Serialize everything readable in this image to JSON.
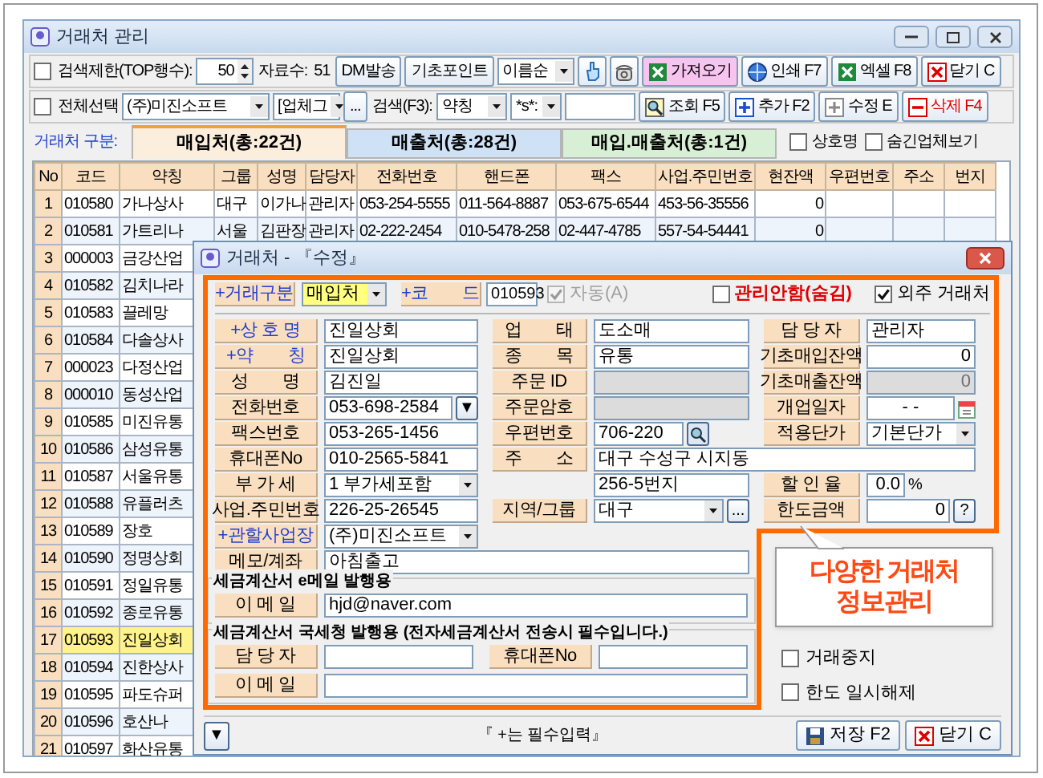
{
  "window": {
    "title": "거래처 관리"
  },
  "toolbar_1": [
    {
      "kind": "checkbox",
      "label": "검색제한(TOP행수):",
      "checked": false
    },
    {
      "kind": "spin",
      "value": "50"
    },
    {
      "kind": "label",
      "text": "자료수:"
    },
    {
      "kind": "label",
      "text": "51"
    },
    {
      "kind": "button",
      "label": "DM발송"
    },
    {
      "kind": "button",
      "label": "기초포인트"
    },
    {
      "kind": "select",
      "value": "이름순"
    },
    {
      "kind": "icon_button"
    },
    {
      "kind": "icon_button"
    },
    {
      "kind": "accent_button",
      "label": "가져오기"
    },
    {
      "kind": "button",
      "label": "인쇄 F7"
    },
    {
      "kind": "button",
      "label": "엑셀 F8"
    },
    {
      "kind": "button",
      "label": "닫기 C"
    }
  ],
  "toolbar_2": [
    {
      "kind": "checkbox",
      "label": "전체선택",
      "checked": false
    },
    {
      "kind": "select",
      "value": "(주)미진소프트"
    },
    {
      "kind": "select",
      "value": "[업체그"
    },
    {
      "kind": "button",
      "label": "..."
    },
    {
      "kind": "label",
      "text": "검색(F3):"
    },
    {
      "kind": "select",
      "value": "약칭"
    },
    {
      "kind": "select",
      "value": "*s*:"
    },
    {
      "kind": "input"
    },
    {
      "kind": "button",
      "label": "조회 F5"
    },
    {
      "kind": "button",
      "label": "추가 F2"
    },
    {
      "kind": "button",
      "label": "수정 E"
    },
    {
      "kind": "danger_button",
      "label": "삭제 F4"
    }
  ],
  "category_label": "거래처 구분:",
  "tabs": [
    {
      "label": "매입처(총:22건)",
      "selected": true,
      "color": "#fbeedd"
    },
    {
      "label": "매출처(총:28건)",
      "selected": false,
      "color": "#cfe2f5"
    },
    {
      "label": "매입.매출처(총:1건)",
      "selected": false,
      "color": "#d7efd4"
    }
  ],
  "filters": [
    {
      "label": "상호명",
      "checked": false
    },
    {
      "label": "숨긴업체보기",
      "checked": false
    }
  ],
  "table": {
    "columns": [
      "No",
      "코드",
      "약칭",
      "그룹",
      "성명",
      "담당자",
      "전화번호",
      "핸드폰",
      "팩스",
      "사업.주민번호",
      "현잔액",
      "우편번호",
      "주소",
      "번지"
    ],
    "rows": [
      {
        "selected": false,
        "cells": [
          "1",
          "010580",
          "가나상사",
          "대구",
          "이가나",
          "관리자",
          "053-254-5555",
          "011-564-8887",
          "053-675-6544",
          "453-56-35556",
          "0"
        ]
      },
      {
        "selected": false,
        "cells": [
          "2",
          "010581",
          "가트리나",
          "서울",
          "김판장",
          "관리자",
          "02-222-2454",
          "010-5478-258",
          "02-447-4785",
          "557-54-54441",
          "0"
        ]
      },
      {
        "selected": false,
        "cells": [
          "3",
          "000003",
          "금강산업"
        ]
      },
      {
        "selected": false,
        "cells": [
          "4",
          "010582",
          "김치나라"
        ]
      },
      {
        "selected": false,
        "cells": [
          "5",
          "010583",
          "끌레망"
        ]
      },
      {
        "selected": false,
        "cells": [
          "6",
          "010584",
          "다솔상사"
        ]
      },
      {
        "selected": false,
        "cells": [
          "7",
          "000023",
          "다정산업"
        ]
      },
      {
        "selected": false,
        "cells": [
          "8",
          "000010",
          "동성산업"
        ]
      },
      {
        "selected": false,
        "cells": [
          "9",
          "010585",
          "미진유통"
        ]
      },
      {
        "selected": false,
        "cells": [
          "10",
          "010586",
          "삼성유통"
        ]
      },
      {
        "selected": false,
        "cells": [
          "11",
          "010587",
          "서울유통"
        ]
      },
      {
        "selected": false,
        "cells": [
          "12",
          "010588",
          "유플러츠"
        ]
      },
      {
        "selected": false,
        "cells": [
          "13",
          "010589",
          "장호"
        ]
      },
      {
        "selected": false,
        "cells": [
          "14",
          "010590",
          "정명상회"
        ]
      },
      {
        "selected": false,
        "cells": [
          "15",
          "010591",
          "정일유통"
        ]
      },
      {
        "selected": false,
        "cells": [
          "16",
          "010592",
          "종로유통"
        ]
      },
      {
        "selected": true,
        "cells": [
          "17",
          "010593",
          "진일상회"
        ]
      },
      {
        "selected": false,
        "cells": [
          "18",
          "010594",
          "진한상사"
        ]
      },
      {
        "selected": false,
        "cells": [
          "19",
          "010595",
          "파도슈퍼"
        ]
      },
      {
        "selected": false,
        "cells": [
          "20",
          "010596",
          "호산나"
        ]
      },
      {
        "selected": false,
        "cells": [
          "21",
          "010597",
          "화산유통"
        ]
      }
    ]
  },
  "dialog": {
    "title": "거래처 - 『수정』",
    "type_field": {
      "label": "+거래구분",
      "value": "매입처"
    },
    "code_field": {
      "label": "+코　　드",
      "value": "010593"
    },
    "checks": [
      {
        "label": "자동(A)",
        "checked": true,
        "disabled": true
      },
      {
        "label": "관리안함(숨김)",
        "checked": false,
        "disabled": false
      },
      {
        "label": "외주 거래처",
        "checked": true,
        "disabled": false
      }
    ],
    "rows": [
      {
        "left": {
          "label": "+상 호 명",
          "value": "진일상회",
          "kind": "text",
          "required": true
        },
        "middle": {
          "label": "업　　태",
          "value": "도소매",
          "kind": "text"
        },
        "right": {
          "label": "담 당 자",
          "value": "관리자",
          "kind": "text"
        }
      },
      {
        "left": {
          "label": "+약　　칭",
          "value": "진일상회",
          "kind": "text",
          "required": true
        },
        "middle": {
          "label": "종　　목",
          "value": "유통",
          "kind": "text"
        },
        "right": {
          "label": "기초매입잔액",
          "value": "0",
          "kind": "number"
        }
      },
      {
        "left": {
          "label": "성　　명",
          "value": "김진일",
          "kind": "text",
          "required": false
        },
        "middle": {
          "label": "주문 ID",
          "kind": "disabled"
        },
        "right": {
          "label": "기초매출잔액",
          "value": "0",
          "kind": "disabled"
        }
      },
      {
        "left": {
          "label": "전화번호",
          "value": "053-698-2584",
          "kind": "phone",
          "button": "▼",
          "required": false
        },
        "middle": {
          "label": "주문암호",
          "kind": "disabled"
        },
        "right": {
          "label": "개업일자",
          "value": "- -",
          "kind": "date"
        }
      },
      {
        "left": {
          "label": "팩스번호",
          "value": "053-265-1456",
          "kind": "text",
          "required": false
        },
        "middle": {
          "label": "우편번호",
          "value": "706-220",
          "kind": "zip"
        },
        "right": {
          "label": "적용단가",
          "value": "기본단가",
          "kind": "select"
        }
      },
      {
        "left": {
          "label": "휴대폰No",
          "value": "010-2565-5841",
          "kind": "text",
          "required": false
        },
        "middle": {
          "label": "주　　소",
          "value": "대구 수성구 시지동",
          "kind": "wide"
        }
      },
      {
        "left": {
          "label": "부 가 세",
          "value": "1 부가세포함",
          "kind": "select",
          "required": false
        },
        "middle": {
          "value": "256-5번지",
          "kind": "text"
        },
        "right": {
          "label": "할 인 율",
          "value": "0.0",
          "kind": "percent",
          "unit": "%"
        }
      },
      {
        "left": {
          "label": "사업.주민번호",
          "value": "226-25-26545",
          "kind": "text",
          "required": false
        },
        "middle": {
          "label": "지역/그룹",
          "value": "대구",
          "kind": "group",
          "button": "..."
        },
        "right": {
          "label": "한도금액",
          "value": "0",
          "kind": "limit",
          "button": "?"
        }
      },
      {
        "left": {
          "label": "+관할사업장",
          "value": "(주)미진소프트",
          "kind": "select",
          "required": true
        }
      },
      {
        "left": {
          "label": "메모/계좌",
          "value": "아침출고",
          "kind": "wide",
          "required": false
        }
      }
    ],
    "sections": [
      {
        "title": "세금계산서 e메일 발행용",
        "rows": [
          [
            {
              "label": "이 메 일",
              "value": "hjd@naver.com"
            }
          ]
        ]
      },
      {
        "title": "세금계산서 국세청 발행용 (전자세금계산서 전송시 필수입니다.)",
        "rows": [
          [
            {
              "label": "담 당 자"
            },
            {
              "label": "휴대폰No"
            }
          ],
          [
            {
              "label": "이 메 일"
            }
          ]
        ]
      }
    ],
    "side_checks": [
      {
        "label": "거래중지",
        "checked": false
      },
      {
        "label": "한도 일시해제",
        "checked": false
      }
    ],
    "callout": "다양한 거래처 정보관리",
    "footer": {
      "expand_button": "▼",
      "note": "『 +는 필수입력』",
      "buttons": [
        "저장 F2",
        "닫기 C"
      ]
    }
  }
}
